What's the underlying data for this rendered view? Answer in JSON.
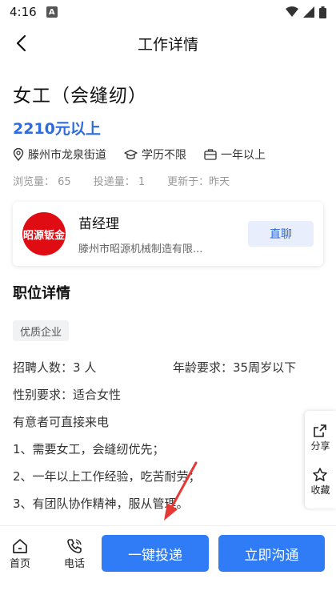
{
  "status_bar": {
    "time": "4:16",
    "notification_icon": "A"
  },
  "nav": {
    "title": "工作详情"
  },
  "job": {
    "title": "女工（会缝纫）",
    "salary": "2210元以上",
    "location": "滕州市龙泉街道",
    "education": "学历不限",
    "experience": "一年以上",
    "views_label": "浏览量：",
    "views": "65",
    "applications_label": "投递量：",
    "applications": "1",
    "updated_label": "更新于：",
    "updated": "昨天"
  },
  "company": {
    "logo_text": "昭源钣金",
    "contact_name": "苗经理",
    "name": "滕州市昭源机械制造有限...",
    "chat_label": "直聊"
  },
  "details": {
    "section_title": "职位详情",
    "tag": "优质企业",
    "headcount_label": "招聘人数：",
    "headcount": "3 人",
    "age_label": "年龄要求：",
    "age": "35周岁以下",
    "gender_label": "性别要求：",
    "gender": "适合女性",
    "lines": [
      "有意者可直接来电",
      "1、需要女工，会缝纫优先；",
      "2、一年以上工作经验，吃苦耐劳；",
      "3、有团队协作精神，服从管理。"
    ]
  },
  "float_panel": {
    "share": "分享",
    "favorite": "收藏"
  },
  "bottom_bar": {
    "home": "首页",
    "phone": "电话",
    "apply": "一键投递",
    "contact": "立即沟通"
  },
  "colors": {
    "accent": "#2f7cf6",
    "salary": "#2d6bdf",
    "logo_bg": "#e00c14",
    "annotation_arrow": "#e53935"
  }
}
